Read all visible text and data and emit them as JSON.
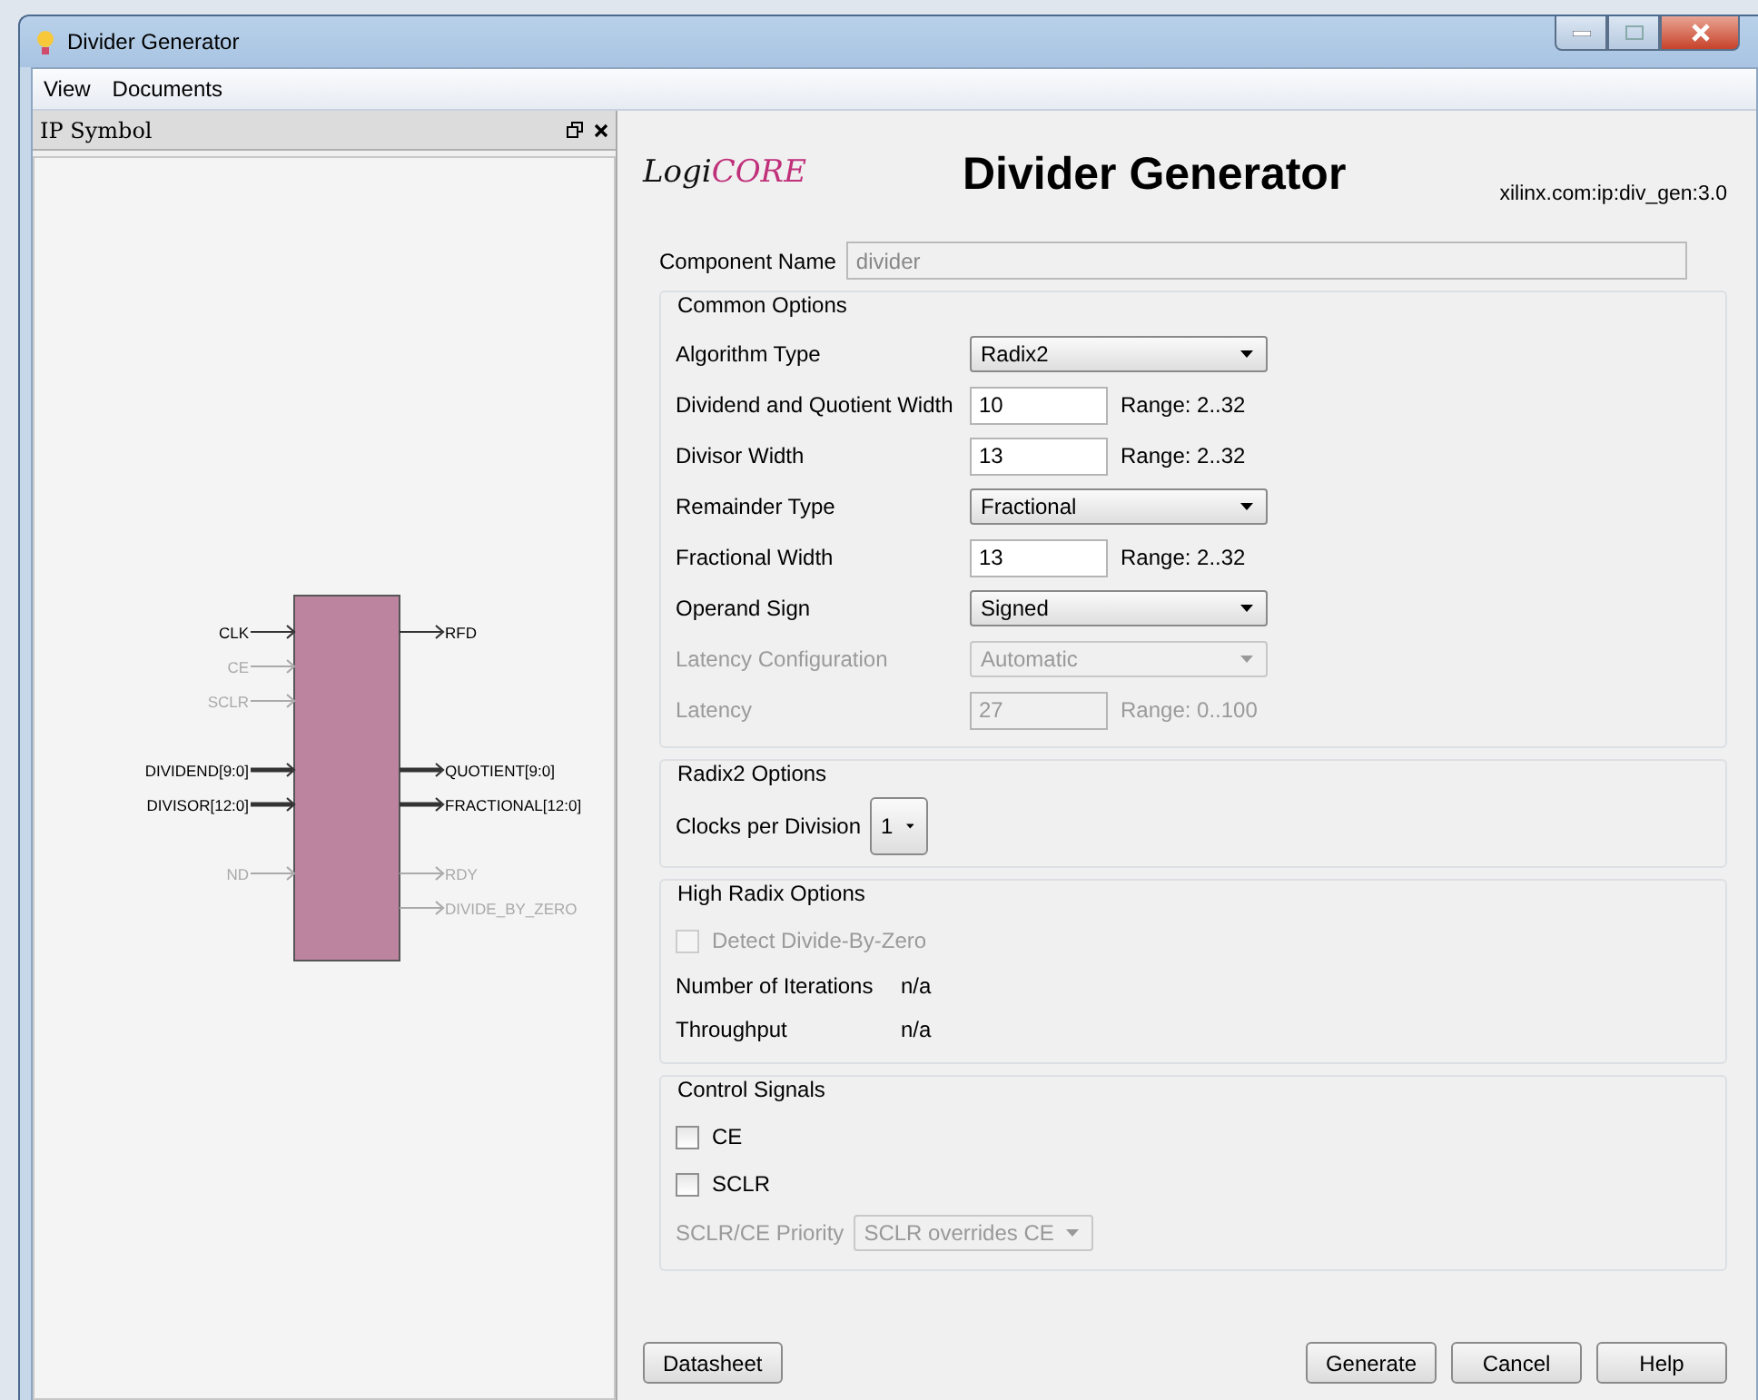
{
  "window": {
    "title": "Divider Generator"
  },
  "menu": [
    "View",
    "Documents"
  ],
  "ip_symbol": {
    "title": "IP Symbol",
    "rows": [
      {
        "kind": "port",
        "left": {
          "name": "CLK",
          "bus": false,
          "enabled": true
        },
        "right": {
          "name": "RFD",
          "bus": false,
          "enabled": true
        }
      },
      {
        "kind": "port",
        "left": {
          "name": "CE",
          "bus": false,
          "enabled": false
        }
      },
      {
        "kind": "port",
        "left": {
          "name": "SCLR",
          "bus": false,
          "enabled": false
        }
      },
      {
        "kind": "spacer"
      },
      {
        "kind": "port",
        "left": {
          "name": "DIVIDEND[9:0]",
          "bus": true,
          "enabled": true
        },
        "right": {
          "name": "QUOTIENT[9:0]",
          "bus": true,
          "enabled": true
        }
      },
      {
        "kind": "port",
        "left": {
          "name": "DIVISOR[12:0]",
          "bus": true,
          "enabled": true
        },
        "right": {
          "name": "FRACTIONAL[12:0]",
          "bus": true,
          "enabled": true
        }
      },
      {
        "kind": "spacer"
      },
      {
        "kind": "port",
        "left": {
          "name": "ND",
          "bus": false,
          "enabled": false
        },
        "right": {
          "name": "RDY",
          "bus": false,
          "enabled": false
        }
      },
      {
        "kind": "port",
        "right": {
          "name": "DIVIDE_BY_ZERO",
          "bus": false,
          "enabled": false
        }
      }
    ]
  },
  "header": {
    "logo": [
      "Logi",
      "CORE"
    ],
    "title": "Divider Generator",
    "vlnv": "xilinx.com:ip:div_gen:3.0"
  },
  "component_name": {
    "label": "Component Name",
    "value": "divider"
  },
  "groups": [
    {
      "title": "Common Options",
      "fields": [
        {
          "kind": "select",
          "label": "Algorithm Type",
          "value": "Radix2",
          "disabled": false
        },
        {
          "kind": "text",
          "label": "Dividend and Quotient Width",
          "value": "10",
          "range": "Range: 2..32",
          "disabled": false
        },
        {
          "kind": "text",
          "label": "Divisor Width",
          "value": "13",
          "range": "Range: 2..32",
          "disabled": false
        },
        {
          "kind": "select",
          "label": "Remainder Type",
          "value": "Fractional",
          "disabled": false
        },
        {
          "kind": "text",
          "label": "Fractional Width",
          "value": "13",
          "range": "Range: 2..32",
          "disabled": false
        },
        {
          "kind": "select",
          "label": "Operand Sign",
          "value": "Signed",
          "disabled": false
        },
        {
          "kind": "select",
          "label": "Latency Configuration",
          "value": "Automatic",
          "disabled": true
        },
        {
          "kind": "text",
          "label": "Latency",
          "value": "27",
          "range": "Range: 0..100",
          "disabled": true
        }
      ]
    },
    {
      "title": "Radix2 Options",
      "fields": [
        {
          "kind": "small-select",
          "label": "Clocks per Division",
          "value": "1",
          "disabled": false
        }
      ]
    },
    {
      "title": "High Radix Options",
      "fields": [
        {
          "kind": "checkbox",
          "label": "Detect Divide-By-Zero",
          "checked": false,
          "disabled": true
        },
        {
          "kind": "info",
          "label": "Number of Iterations",
          "value": "n/a"
        },
        {
          "kind": "info",
          "label": "Throughput",
          "value": "n/a"
        }
      ]
    },
    {
      "title": "Control Signals",
      "fields": [
        {
          "kind": "checkbox",
          "label": "CE",
          "checked": false,
          "disabled": false
        },
        {
          "kind": "checkbox",
          "label": "SCLR",
          "checked": false,
          "disabled": false
        },
        {
          "kind": "inline-select",
          "label": "SCLR/CE Priority",
          "value": "SCLR overrides CE",
          "disabled": true
        }
      ]
    }
  ],
  "buttons": {
    "left": [
      "Datasheet"
    ],
    "right": [
      "Generate",
      "Cancel",
      "Help"
    ]
  }
}
